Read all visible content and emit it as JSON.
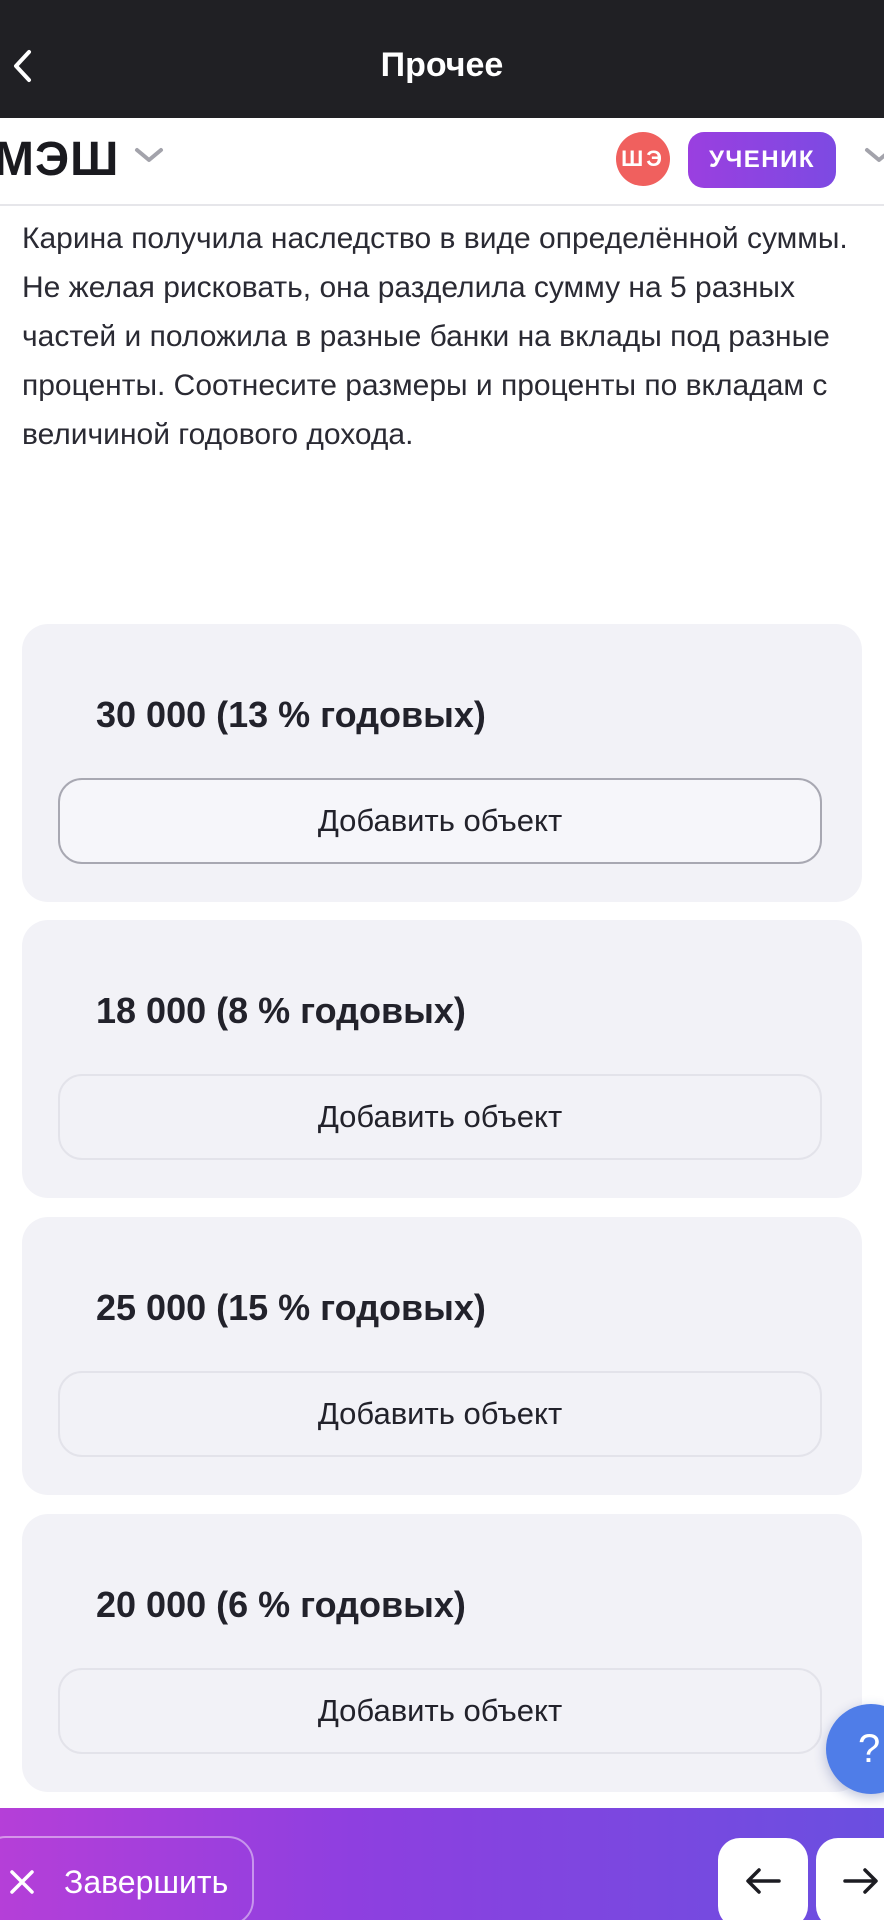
{
  "topbar": {
    "title": "Прочее",
    "back_icon": "chevron-left-icon"
  },
  "header": {
    "logo": "МЭШ",
    "avatar_initials": "ШЭ",
    "role_badge": "УЧЕНИК",
    "colors": {
      "avatar": "#f0605e",
      "badge": "#8a44e0"
    }
  },
  "question": {
    "text": "Карина получила наследство в виде определённой суммы. Не желая рисковать, она разделила сумму на 5 разных частей и положила в разные банки на вклады под разные проценты. Соотнесите размеры и проценты по вкладам с величиной годового дохода."
  },
  "cards": [
    {
      "title": "30 000 (13 % годовых)",
      "button": "Добавить объект"
    },
    {
      "title": "18 000 (8 % годовых)",
      "button": "Добавить объект"
    },
    {
      "title": "25 000 (15 % годовых)",
      "button": "Добавить объект"
    },
    {
      "title": "20 000 (6 % годовых)",
      "button": "Добавить объект"
    }
  ],
  "help": {
    "label": "?"
  },
  "footer": {
    "finish_label": "Завершить",
    "prev_icon": "arrow-left-icon",
    "next_icon": "arrow-right-icon"
  }
}
